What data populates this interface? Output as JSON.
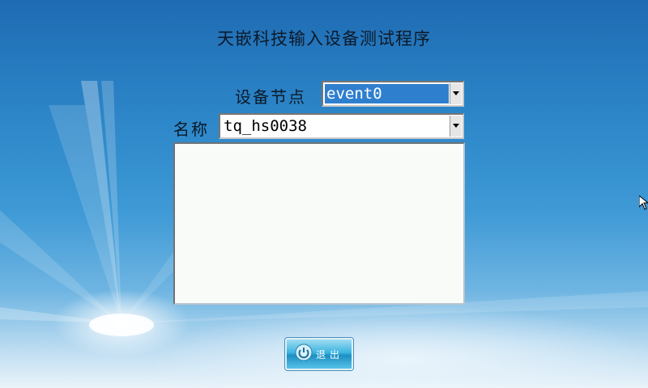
{
  "window": {
    "title": "天嵌科技输入设备测试程序"
  },
  "device_node": {
    "label": "设备节点",
    "selected": "event0"
  },
  "name_field": {
    "label": "名称",
    "selected": "tq_hs0038"
  },
  "output": {
    "text": ""
  },
  "exit_button": {
    "label": "退出",
    "icon": "power-icon"
  },
  "icons": {
    "dropdown": "chevron-down-icon",
    "cursor": "mouse-pointer-icon"
  }
}
